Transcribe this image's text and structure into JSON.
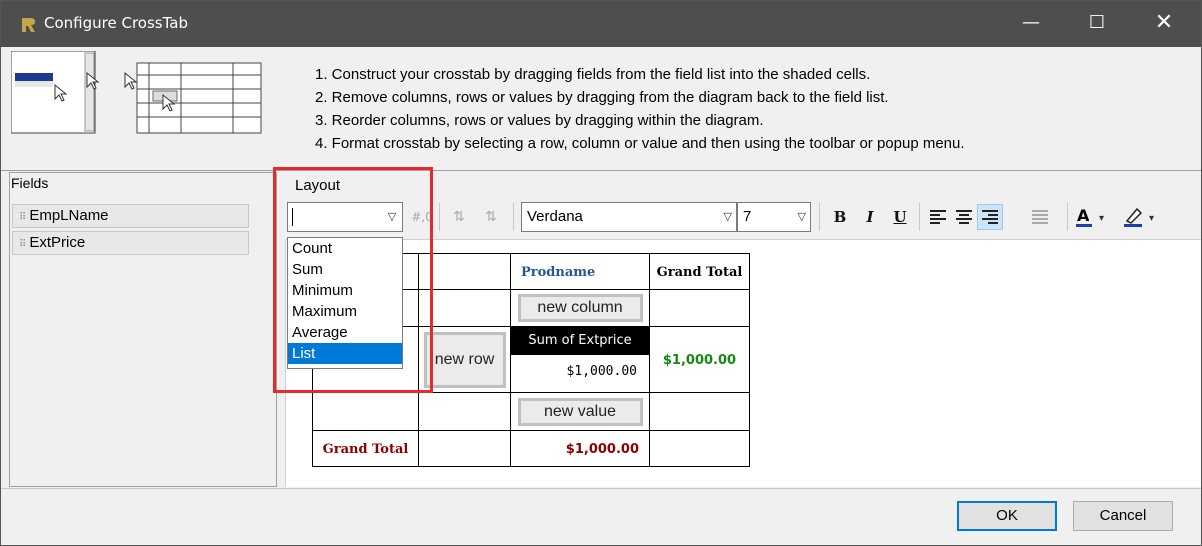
{
  "window": {
    "title": "Configure CrossTab",
    "minimize_glyph": "—",
    "maximize_glyph": "☐",
    "close_glyph": "✕"
  },
  "instructions": [
    "1. Construct your crosstab by dragging fields from the field list into the shaded cells.",
    "2. Remove columns, rows or values by dragging from the diagram back to the field list.",
    "3. Reorder columns, rows or values by dragging within the diagram.",
    "4. Format crosstab by selecting a row, column or value and then using the toolbar or popup menu."
  ],
  "fields": {
    "header": "Fields",
    "items": [
      "EmpLName",
      "ExtPrice"
    ]
  },
  "layout": {
    "header": "Layout",
    "toolbar": {
      "aggregate_value": "",
      "number_format_icon": "#,0",
      "font": "Verdana",
      "size": "7"
    },
    "aggregate_options": [
      "Count",
      "Sum",
      "Minimum",
      "Maximum",
      "Average",
      "List"
    ],
    "selected_option": "List"
  },
  "crosstab": {
    "prodname": "Prodname",
    "grand_total_header": "Grand Total",
    "new_column": "new column",
    "new_row": "new row",
    "sum_label": "Sum of Extprice",
    "value": "$1,000.00",
    "row_grand_total": "$1,000.00",
    "new_value": "new value",
    "grand_total_row_label": "Grand Total",
    "grand_total_row_value": "$1,000.00"
  },
  "buttons": {
    "ok": "OK",
    "cancel": "Cancel"
  },
  "colors": {
    "selection": "#0078d7",
    "highlight_box": "#e22a2f",
    "green_total": "#128a12",
    "dark_red_total": "#8b0000",
    "header_blue": "#245797"
  }
}
